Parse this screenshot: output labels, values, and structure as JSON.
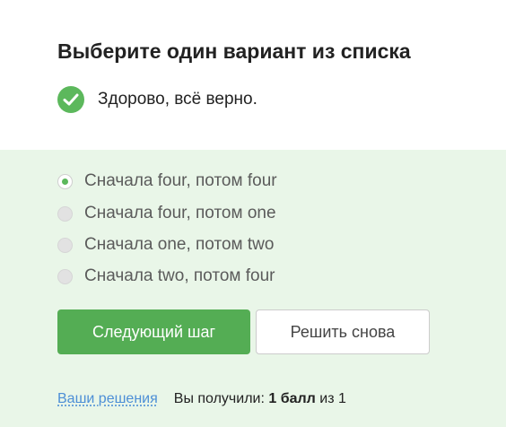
{
  "title": "Выберите один вариант из списка",
  "feedback": {
    "icon": "checkmark-icon",
    "text": "Здорово, всё верно.",
    "color": "#5cb85c"
  },
  "options": [
    {
      "label": "Сначала four, потом four",
      "selected": true
    },
    {
      "label": "Сначала four, потом one",
      "selected": false
    },
    {
      "label": "Сначала one, потом two",
      "selected": false
    },
    {
      "label": "Сначала two, потом four",
      "selected": false
    }
  ],
  "buttons": {
    "next_label": "Следующий шаг",
    "retry_label": "Решить снова"
  },
  "footer": {
    "solutions_link": "Ваши решения",
    "score_prefix": "Вы получили:",
    "score_value": "1 балл",
    "score_suffix": "из 1"
  },
  "colors": {
    "accent": "#54ad54",
    "panel_bg": "#e9f6e8",
    "link": "#4d8fd6"
  }
}
